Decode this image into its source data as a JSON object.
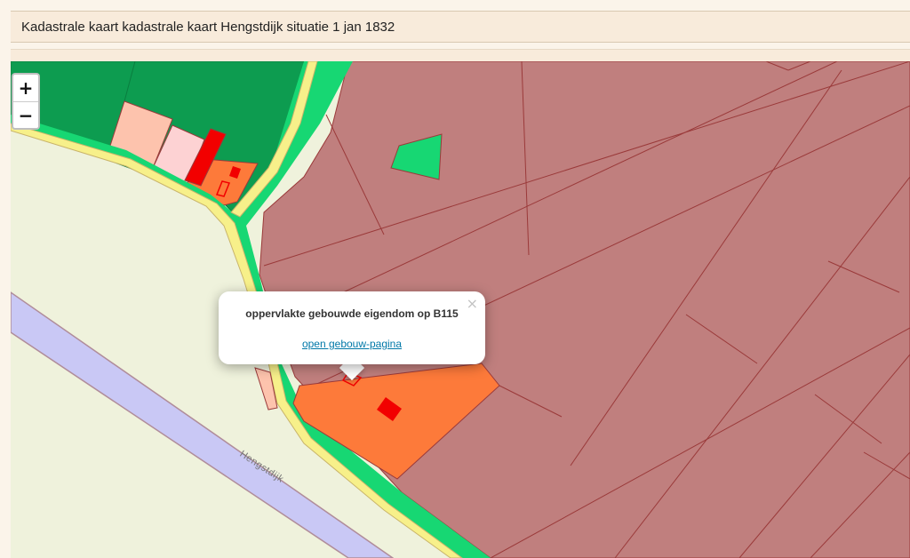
{
  "header": {
    "title": "Kadastrale kaart kadastrale kaart Hengstdijk situatie 1 jan 1832"
  },
  "zoom": {
    "zoom_in_label": "+",
    "zoom_out_label": "−"
  },
  "popup": {
    "title": "oppervlakte gebouwde eigendom op B115",
    "link_label": "open gebouw-pagina",
    "close_label": "×"
  },
  "map": {
    "street_label": "Hengstdijk"
  },
  "colors": {
    "farmland": "#c07f7e",
    "parcel_line": "#9a3a3a",
    "garden_green": "#0d9c50",
    "road_verge": "#17d773",
    "road_yellow": "#f7f08a",
    "built_orange": "#fd7a3a",
    "building_red": "#f20000",
    "water": "#c9c8f5",
    "background_land": "#eff2dc",
    "link": "#0078a8"
  }
}
